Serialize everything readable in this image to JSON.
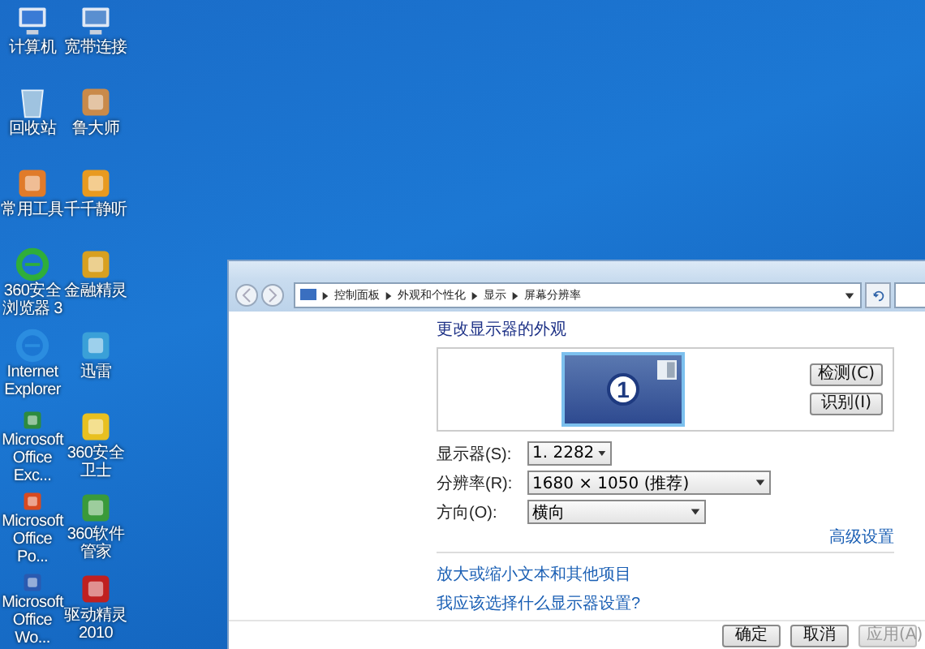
{
  "desktop_icons": [
    {
      "label": "计算机",
      "kind": "computer"
    },
    {
      "label": "宽带连接",
      "kind": "network"
    },
    {
      "label": "回收站",
      "kind": "bin"
    },
    {
      "label": "鲁大师",
      "kind": "person"
    },
    {
      "label": "常用工具",
      "kind": "butterfly"
    },
    {
      "label": "千千静听",
      "kind": "headphones"
    },
    {
      "label": "360安全浏览器 3",
      "kind": "browser"
    },
    {
      "label": "金融精灵",
      "kind": "books"
    },
    {
      "label": "Internet Explorer",
      "kind": "ie"
    },
    {
      "label": "迅雷",
      "kind": "bird"
    },
    {
      "label": "Microsoft Office Exc...",
      "kind": "excel"
    },
    {
      "label": "360安全卫士",
      "kind": "plus"
    },
    {
      "label": "Microsoft Office Po...",
      "kind": "ppt"
    },
    {
      "label": "360软件管家",
      "kind": "squares"
    },
    {
      "label": "Microsoft Office Wo...",
      "kind": "word"
    },
    {
      "label": "驱动精灵 2010",
      "kind": "driver"
    }
  ],
  "window": {
    "breadcrumb": [
      "控制面板",
      "外观和个性化",
      "显示",
      "屏幕分辨率"
    ],
    "heading": "更改显示器的外观",
    "monitor_number": "1",
    "side_buttons": [
      "检测(C)",
      "识别(I)"
    ],
    "settings": [
      {
        "label": "显示器(S):",
        "value": "1. 2282"
      },
      {
        "label": "分辨率(R):",
        "value": "1680 × 1050 (推荐)"
      },
      {
        "label": "方向(O):",
        "value": "横向"
      }
    ],
    "advanced_link": "高级设置",
    "links": [
      "放大或缩小文本和其他项目",
      "我应该选择什么显示器设置?"
    ],
    "buttons": [
      {
        "label": "确定",
        "disabled": false
      },
      {
        "label": "取消",
        "disabled": false
      },
      {
        "label": "应用(A)",
        "disabled": true
      }
    ]
  }
}
